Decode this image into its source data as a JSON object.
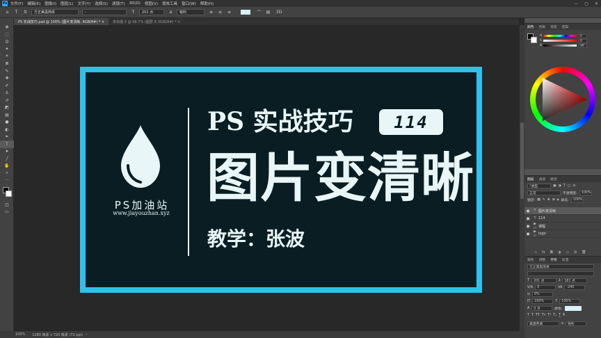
{
  "app": {
    "logo": "Ps"
  },
  "menu": [
    "文件(F)",
    "编辑(E)",
    "图像(I)",
    "图层(L)",
    "文字(Y)",
    "选择(S)",
    "滤镜(T)",
    "3D(D)",
    "视图(V)",
    "增效工具",
    "窗口(W)",
    "帮助(H)"
  ],
  "window_controls": {
    "minimize": "—",
    "maximize": "▢",
    "close": "✕"
  },
  "options_bar": {
    "font_family": "方正美黑简体",
    "font_style": "-",
    "font_size": "201 点",
    "antialias": "锐利",
    "mode_3d": "3D"
  },
  "tabs": [
    {
      "label": "PS 实战技巧.psd @ 100% (图片变清晰, RGB/8#) *  ×",
      "active": true
    },
    {
      "label": "未标题-1 @ 66.7% (图层 9, RGB/8#) *  ×",
      "active": false
    }
  ],
  "tools": [
    {
      "name": "move-tool",
      "glyph": "✥"
    },
    {
      "name": "marquee-tool",
      "glyph": "⬚"
    },
    {
      "name": "lasso-tool",
      "glyph": "ʘ"
    },
    {
      "name": "magic-wand-tool",
      "glyph": "✦"
    },
    {
      "name": "crop-tool",
      "glyph": "⌗"
    },
    {
      "name": "frame-tool",
      "glyph": "⊠"
    },
    {
      "name": "eyedropper-tool",
      "glyph": "✎"
    },
    {
      "name": "healing-tool",
      "glyph": "✚"
    },
    {
      "name": "brush-tool",
      "glyph": "✐"
    },
    {
      "name": "stamp-tool",
      "glyph": "♙"
    },
    {
      "name": "history-brush-tool",
      "glyph": "↺"
    },
    {
      "name": "eraser-tool",
      "glyph": "◩"
    },
    {
      "name": "gradient-tool",
      "glyph": "▤"
    },
    {
      "name": "blur-tool",
      "glyph": "●"
    },
    {
      "name": "dodge-tool",
      "glyph": "◐"
    },
    {
      "name": "pen-tool",
      "glyph": "✒"
    },
    {
      "name": "type-tool",
      "glyph": "T"
    },
    {
      "name": "path-select-tool",
      "glyph": "➤"
    },
    {
      "name": "line-tool",
      "glyph": "╱"
    },
    {
      "name": "hand-tool",
      "glyph": "✋"
    },
    {
      "name": "zoom-tool",
      "glyph": "⌕"
    },
    {
      "name": "more-tools",
      "glyph": "···"
    }
  ],
  "artwork": {
    "brand_name": "PS加油站",
    "brand_url": "www.jiayouzhan.xyz",
    "headline": "PS 实战技巧",
    "badge_number": "114",
    "title": "图片变清晰",
    "teacher": "教学：张波",
    "colors": {
      "frame": "#2fc1ee",
      "background": "#0a1d23",
      "text": "#e8f6f8"
    }
  },
  "status": {
    "zoom": "100%",
    "doc_info": "1280 像素 x 720 像素 (72 ppi)",
    "arrow": "›"
  },
  "color_panel": {
    "tabs": [
      "颜色",
      "色板",
      "渐变",
      "图案"
    ],
    "values": [
      "0",
      "0",
      "99"
    ]
  },
  "layers_panel": {
    "tabs": [
      "图层",
      "通道",
      "路径"
    ],
    "filter_kind": "类型",
    "blend_mode": "正常",
    "opacity_label": "不透明度:",
    "opacity": "100%",
    "lock_label": "锁定:",
    "fill_label": "填充:",
    "fill": "100%",
    "layers": [
      {
        "name": "图片变清晰",
        "type": "T",
        "selected": true
      },
      {
        "name": "114",
        "type": "T",
        "selected": false
      },
      {
        "name": "课程",
        "type": "folder",
        "selected": false
      },
      {
        "name": "logo",
        "type": "folder",
        "selected": false
      }
    ]
  },
  "character_panel": {
    "tabs": [
      "属性",
      "调整",
      "字符",
      "段落"
    ],
    "font_family": "方正美黑简体",
    "font_style": "-",
    "size": "201 点",
    "leading": "181 点",
    "kerning": "0",
    "tracking": "-240",
    "scale_label": "0%",
    "vscale": "100%",
    "hscale": "100%",
    "baseline": "0 点",
    "color_label": "颜色:",
    "language": "美国英语",
    "antialias": "锐利"
  }
}
